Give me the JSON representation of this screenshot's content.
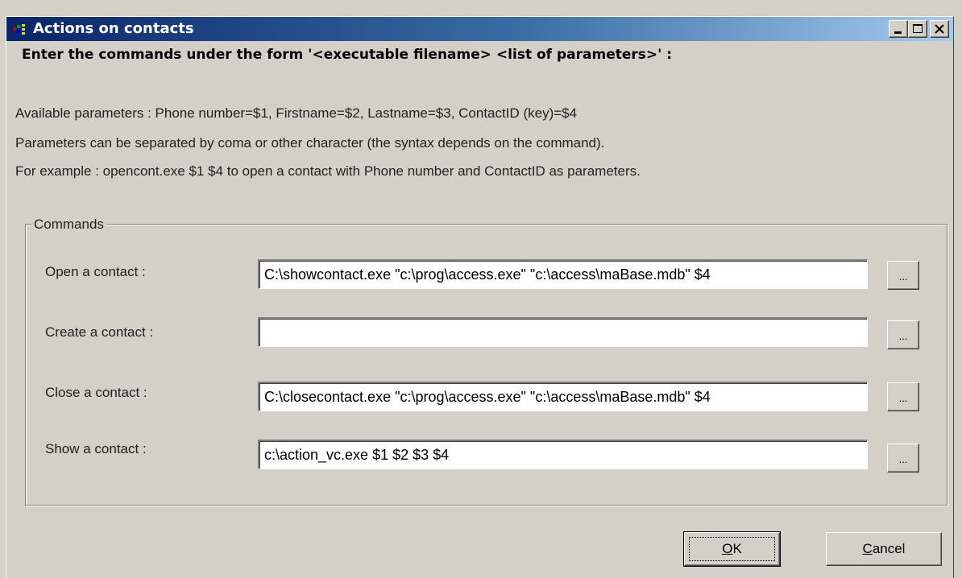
{
  "window": {
    "title": "Actions on contacts"
  },
  "heading": "Enter the commands under the form '<executable filename> <list of parameters>' :",
  "info_lines": [
    "Available parameters : Phone number=$1, Firstname=$2, Lastname=$3, ContactID (key)=$4",
    "Parameters can be separated by coma or other character (the syntax depends on the command).",
    "For example : opencont.exe $1 $4 to open a contact with Phone number and ContactID as parameters."
  ],
  "commands": {
    "group_label": "Commands",
    "rows": [
      {
        "label": "Open a contact :",
        "value": "C:\\showcontact.exe \"c:\\prog\\access.exe\" \"c:\\access\\maBase.mdb\" $4",
        "browse": "..."
      },
      {
        "label": "Create a contact :",
        "value": "",
        "browse": "..."
      },
      {
        "label": "Close a contact :",
        "value": "C:\\closecontact.exe \"c:\\prog\\access.exe\" \"c:\\access\\maBase.mdb\" $4",
        "browse": "..."
      },
      {
        "label": "Show a contact :",
        "value": "c:\\action_vc.exe $1 $2 $3 $4",
        "browse": "..."
      }
    ]
  },
  "buttons": {
    "ok_accel": "O",
    "ok_rest": "K",
    "cancel_accel": "C",
    "cancel_rest": "ancel"
  },
  "colors": {
    "titlebar_start": "#0a246a",
    "titlebar_end": "#a6caf0",
    "face": "#d4d0c8"
  }
}
